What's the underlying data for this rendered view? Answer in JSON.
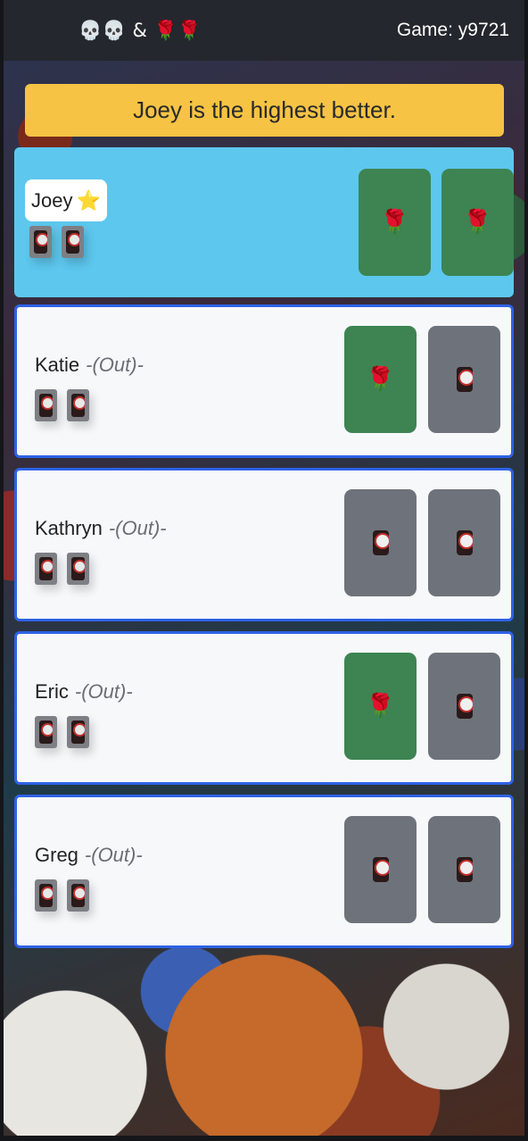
{
  "header": {
    "logo": "💀💀 & 🌹🌹",
    "game_id": "Game: y9721"
  },
  "banner": {
    "text": "Joey is the highest better."
  },
  "players": [
    {
      "name": "Joey",
      "badge": "⭐",
      "status": "",
      "active": true,
      "mini_cards": [
        "coaster",
        "coaster"
      ],
      "cards": [
        "rose",
        "rose"
      ]
    },
    {
      "name": "Katie",
      "badge": "",
      "status": "-(Out)-",
      "active": false,
      "mini_cards": [
        "coaster",
        "coaster"
      ],
      "cards": [
        "rose",
        "back"
      ]
    },
    {
      "name": "Kathryn",
      "badge": "",
      "status": "-(Out)-",
      "active": false,
      "mini_cards": [
        "coaster",
        "coaster"
      ],
      "cards": [
        "back",
        "back"
      ]
    },
    {
      "name": "Eric",
      "badge": "",
      "status": "-(Out)-",
      "active": false,
      "mini_cards": [
        "coaster",
        "coaster"
      ],
      "cards": [
        "rose",
        "back"
      ]
    },
    {
      "name": "Greg",
      "badge": "",
      "status": "-(Out)-",
      "active": false,
      "mini_cards": [
        "coaster",
        "coaster"
      ],
      "cards": [
        "back",
        "back"
      ]
    }
  ],
  "icons": {
    "rose": "🌹",
    "star": "⭐"
  },
  "colors": {
    "topbar": "#24272d",
    "banner": "#f6c344",
    "active_player": "#5dc7ee",
    "player_border": "#2e62e6",
    "rose_card": "#3d8452",
    "back_card": "#6e737b"
  }
}
